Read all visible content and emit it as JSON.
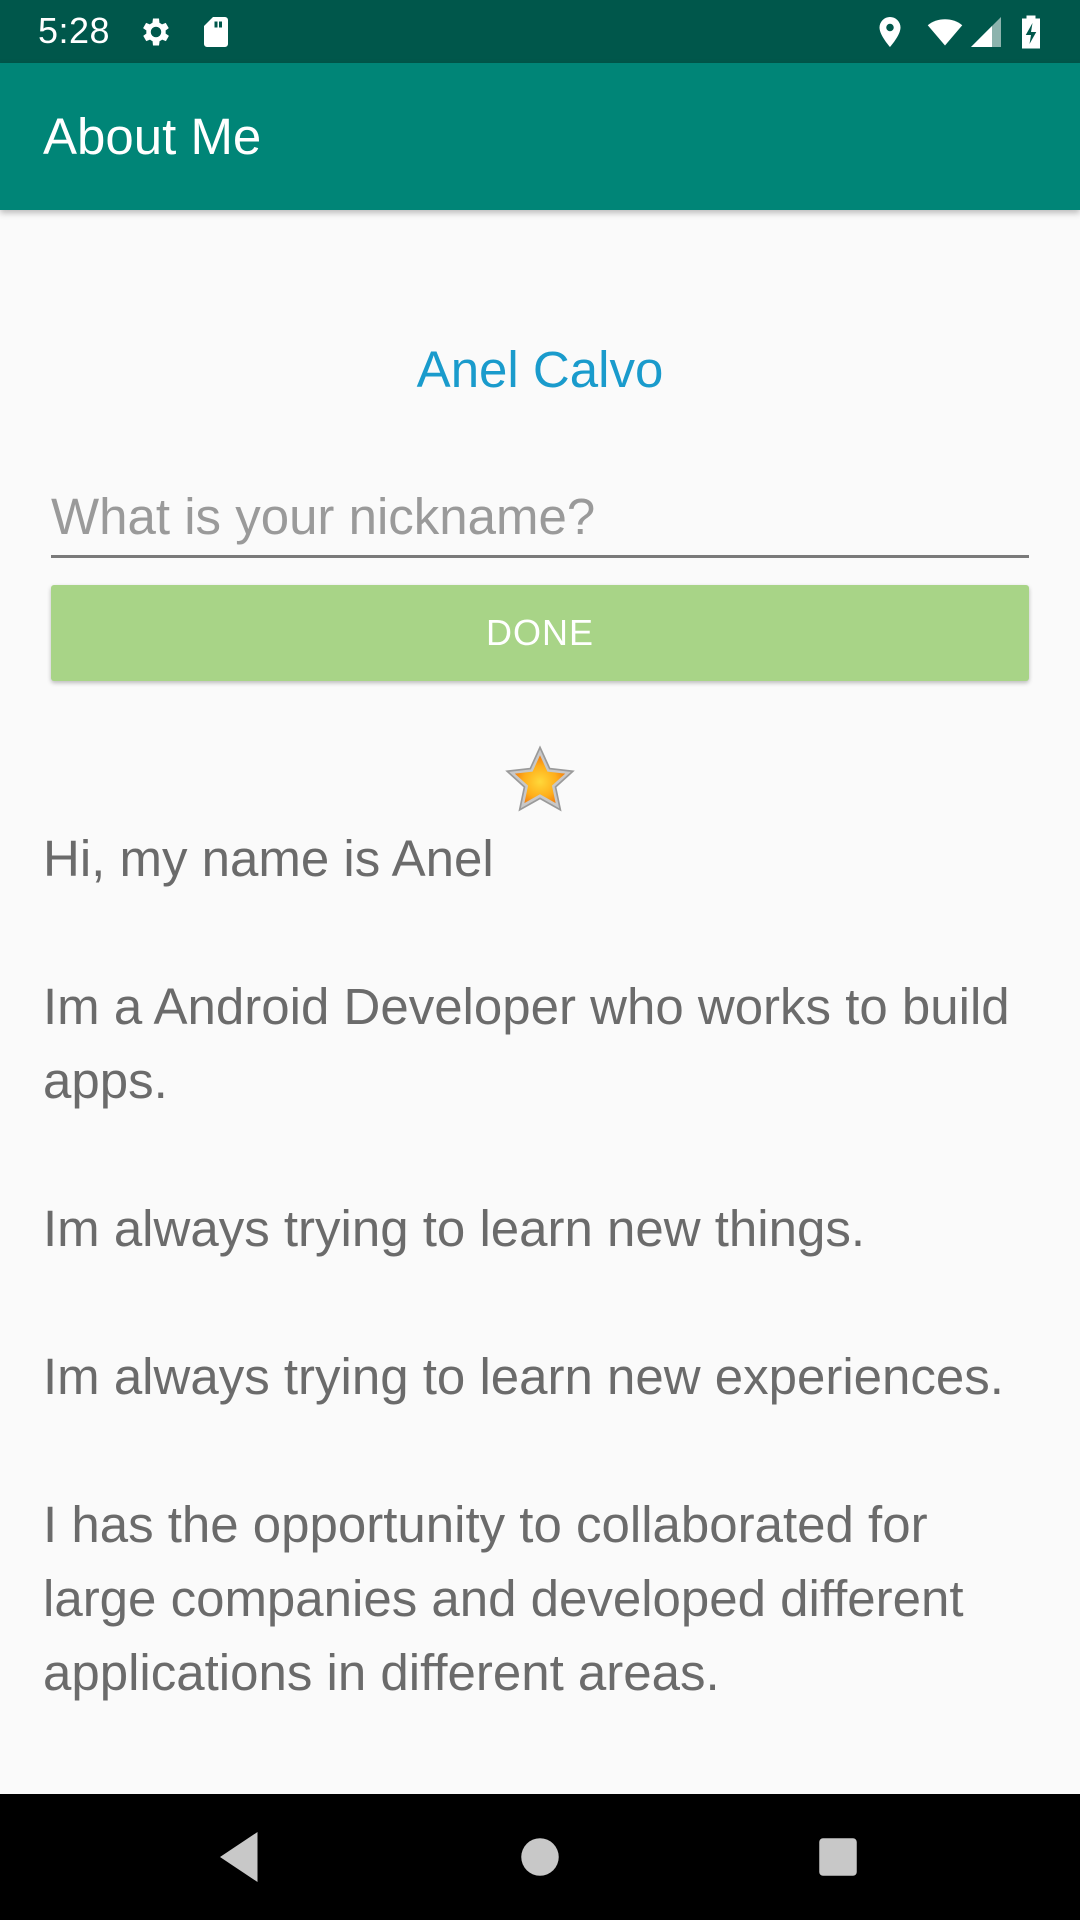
{
  "status_bar": {
    "time": "5:28",
    "icons": [
      "settings-icon",
      "sd-card-icon",
      "location-icon",
      "wifi-icon",
      "signal-icon",
      "battery-charging-icon"
    ]
  },
  "app_bar": {
    "title": "About Me"
  },
  "main": {
    "name": "Anel Calvo",
    "nickname_placeholder": "What is your nickname?",
    "nickname_value": "",
    "done_label": "DONE",
    "star_icon": "star-icon",
    "bio": "Hi, my name is Anel\n\nIm a Android Developer who works to build apps.\n\nIm always trying to learn new things.\n\nIm always trying to learn new experiences.\n\nI has the opportunity to collaborated for large companies and developed different applications in different areas."
  },
  "nav_bar": {
    "icons": [
      "back-icon",
      "home-icon",
      "recents-icon"
    ]
  },
  "colors": {
    "status_bar": "#00574b",
    "app_bar": "#008577",
    "name_accent": "#1a9bcc",
    "done_button": "#a8d487",
    "body_text": "#6b6b6b"
  }
}
